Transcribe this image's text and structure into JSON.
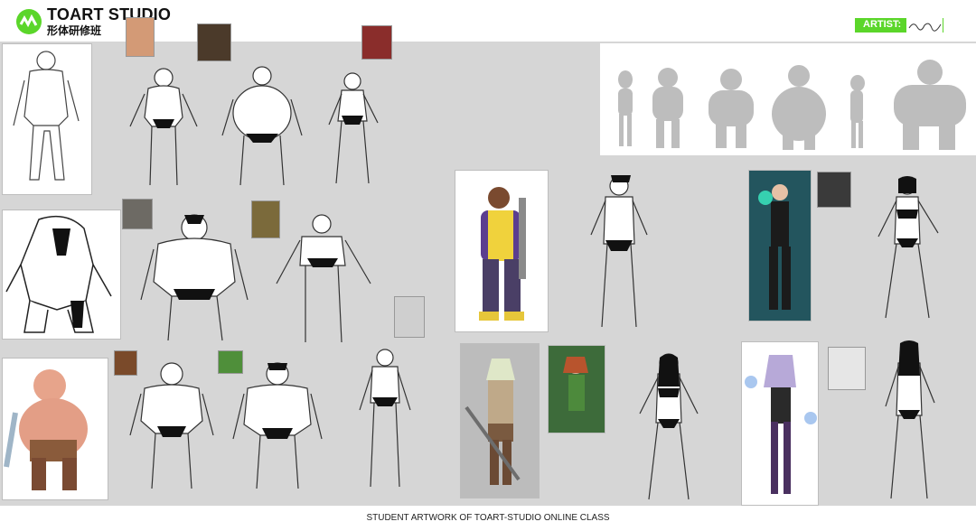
{
  "header": {
    "brand_title": "TOART STUDIO",
    "brand_subtitle": "形体研修班",
    "artist_label": "ARTIST:"
  },
  "footer": {
    "caption": "STUDENT ARTWORK OF TOART-STUDIO ONLINE CLASS"
  },
  "colors": {
    "accent": "#5bd62a",
    "canvas": "#d6d6d6"
  },
  "icons": [
    "logo-icon"
  ]
}
